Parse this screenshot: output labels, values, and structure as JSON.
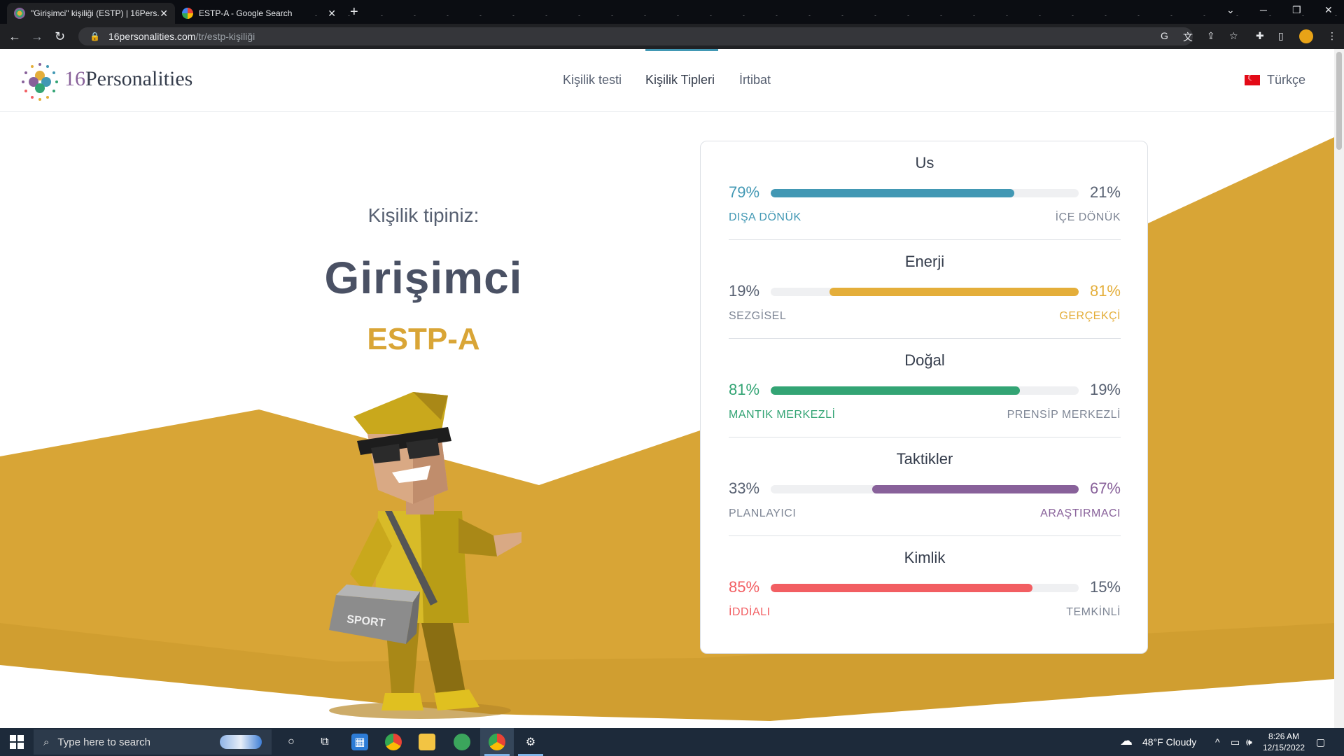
{
  "browser": {
    "tabs": [
      {
        "title": "\"Girişimci\" kişiliği (ESTP) | 16Pers...",
        "active": true
      },
      {
        "title": "ESTP-A - Google Search",
        "active": false
      }
    ],
    "url_host": "16personalities.com",
    "url_path": "/tr/estp-kişiliği"
  },
  "site": {
    "logo_num": "16",
    "logo_text": "Personalities",
    "nav": [
      "Kişilik testi",
      "Kişilik Tipleri",
      "İrtibat"
    ],
    "active_nav": "Kişilik Tipleri",
    "language": "Türkçe"
  },
  "hero": {
    "subtitle": "Kişilik tipiniz:",
    "type_name": "Girişimci",
    "type_code": "ESTP-A",
    "bag_text": "SPORT"
  },
  "traits": [
    {
      "name": "Us",
      "left_pct": "79%",
      "right_pct": "21%",
      "left_label": "DIŞA DÖNÜK",
      "right_label": "İÇE DÖNÜK",
      "value": 79,
      "side": "left",
      "color": "#4298b4"
    },
    {
      "name": "Enerji",
      "left_pct": "19%",
      "right_pct": "81%",
      "left_label": "SEZGİSEL",
      "right_label": "GERÇEKÇİ",
      "value": 81,
      "side": "right",
      "color": "#e4ae3a"
    },
    {
      "name": "Doğal",
      "left_pct": "81%",
      "right_pct": "19%",
      "left_label": "MANTIK MERKEZLİ",
      "right_label": "PRENSİP MERKEZLİ",
      "value": 81,
      "side": "left",
      "color": "#33a474"
    },
    {
      "name": "Taktikler",
      "left_pct": "33%",
      "right_pct": "67%",
      "left_label": "PLANLAYICI",
      "right_label": "ARAŞTIRMACI",
      "value": 67,
      "side": "right",
      "color": "#88619a"
    },
    {
      "name": "Kimlik",
      "left_pct": "85%",
      "right_pct": "15%",
      "left_label": "İDDİALI",
      "right_label": "TEMKİNLİ",
      "value": 85,
      "side": "left",
      "color": "#f25e62"
    }
  ],
  "taskbar": {
    "search_placeholder": "Type here to search",
    "weather": "48°F  Cloudy",
    "time": "8:26 AM",
    "date": "12/15/2022"
  }
}
